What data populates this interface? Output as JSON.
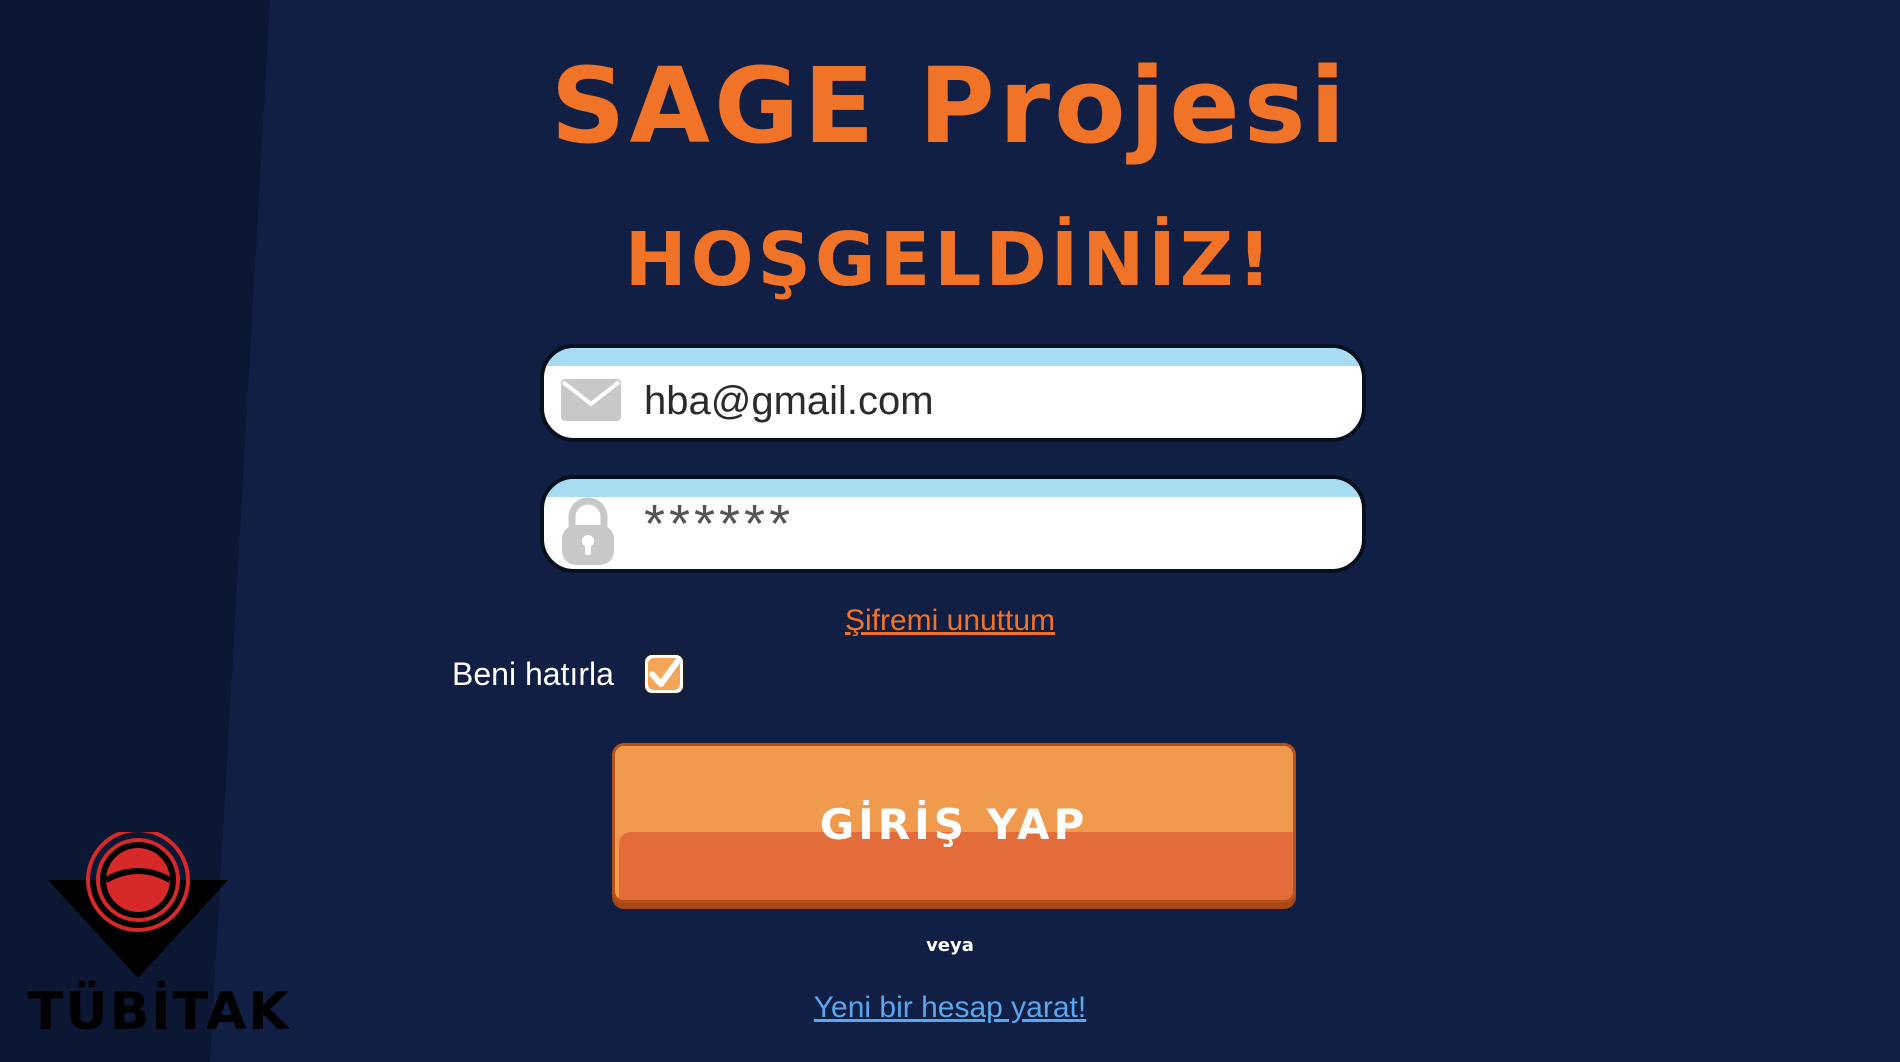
{
  "app": {
    "title": "SAGE Projesi",
    "welcome": "HOŞGELDİNİZ!"
  },
  "login_form": {
    "email": {
      "value": "hba@gmail.com",
      "icon": "envelope-icon"
    },
    "password": {
      "value": "******",
      "icon": "lock-icon"
    },
    "forgot_password_label": "Şifremi unuttum",
    "remember_me": {
      "label": "Beni hatırla",
      "checked": true
    },
    "submit_label": "GİRİŞ YAP",
    "or_label": "veya",
    "create_account_label": "Yeni bir hesap yarat!"
  },
  "logo": {
    "text": "TÜBİTAK"
  },
  "colors": {
    "background": "#101f43",
    "accent": "#f07328",
    "button": "#f09a4e",
    "link_blue": "#5ba6ee",
    "field_top": "#a7dcf3"
  }
}
